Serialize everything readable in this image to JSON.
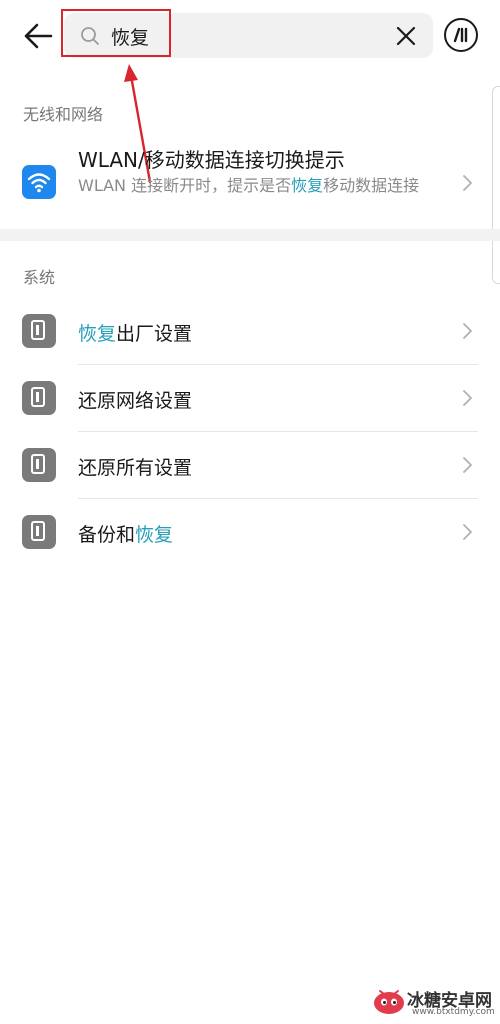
{
  "search": {
    "query": "恢复"
  },
  "sections": {
    "wireless": {
      "header": "无线和网络",
      "item": {
        "title": "WLAN/移动数据连接切换提示",
        "desc_before": "WLAN 连接断开时，提示是否",
        "desc_highlight": "恢复",
        "desc_after": "移动数据连接"
      }
    },
    "system": {
      "header": "系统",
      "items": [
        {
          "highlight": "恢复",
          "rest": "出厂设置"
        },
        {
          "highlight": "",
          "rest": "还原网络设置"
        },
        {
          "highlight": "",
          "rest": "还原所有设置"
        },
        {
          "prefix": "备份和",
          "highlight": "恢复"
        }
      ]
    }
  },
  "watermark": {
    "text": "冰糖安卓网",
    "url": "www.btxtdmy.com"
  },
  "colors": {
    "accent": "#26a0b8",
    "wlan_icon": "#1e88ee",
    "annotation": "#d8262e"
  },
  "icons": {
    "back": "arrow-left-icon",
    "search": "search-icon",
    "clear": "close-icon",
    "voice": "voice-assistant-icon",
    "wlan": "wifi-icon",
    "system_item": "phone-info-icon",
    "chevron": "chevron-right-icon"
  }
}
